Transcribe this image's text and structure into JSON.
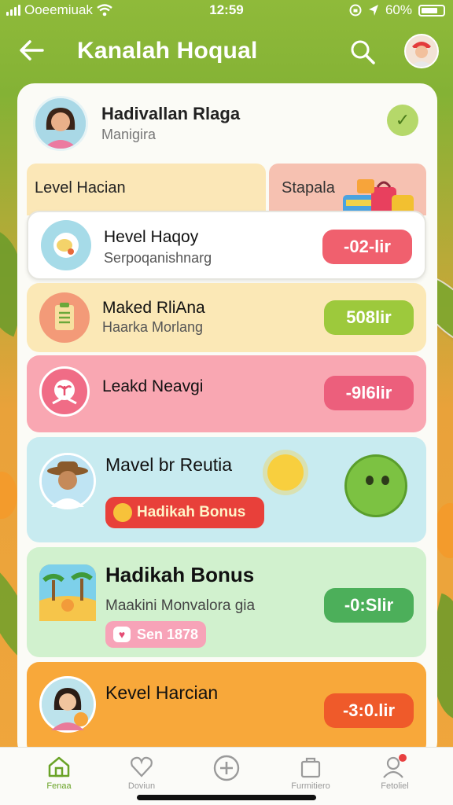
{
  "status_bar": {
    "carrier": "Ooeemiuak",
    "time": "12:59",
    "battery": "60%"
  },
  "header": {
    "title": "Kanalah Hoqual"
  },
  "profile": {
    "name": "Hadivallan Rlaga",
    "subtitle": "Manigira"
  },
  "tabs": [
    {
      "label": "Level Hacian"
    },
    {
      "label": "Stapala"
    }
  ],
  "tasks": [
    {
      "title": "Hevel Haqoy",
      "subtitle": "Serpoqanishnarg",
      "reward": "-02-lir",
      "color": "#f0606e"
    },
    {
      "title": "Maked RliAna",
      "subtitle": "Haarka Morlang",
      "reward": "508lir",
      "color": "#9dc93c"
    },
    {
      "title": "Leakd Neavgi",
      "subtitle": "",
      "reward": "-9l6lir",
      "color": "#ec5f7c"
    }
  ],
  "feature": {
    "title": "Mavel br Reutia",
    "button": "Hadikah Bonus"
  },
  "bonus": {
    "title": "Hadikah Bonus",
    "subtitle": "Maakini Monvalora gia",
    "reward": "-0:Slir",
    "chip": "Sen 1878"
  },
  "daily": {
    "title": "Kevel Harcian",
    "reward": "-3:0.lir"
  },
  "nav": [
    {
      "label": "Fenaa"
    },
    {
      "label": "Doviun"
    },
    {
      "label": ""
    },
    {
      "label": "Furmitiero"
    },
    {
      "label": "Fetoliel"
    }
  ]
}
